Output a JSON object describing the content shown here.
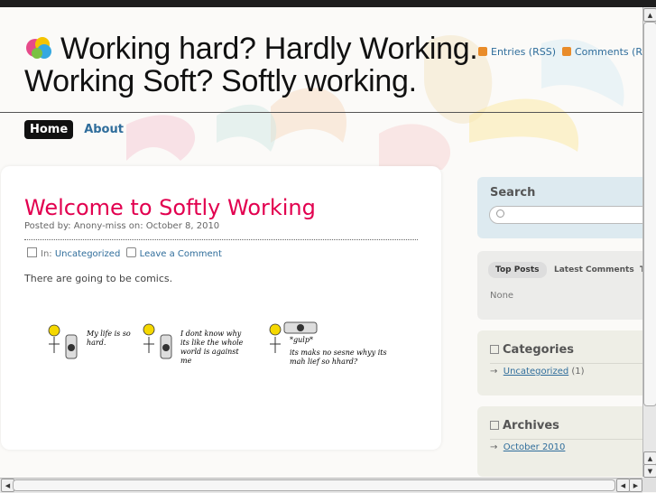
{
  "header": {
    "title_line1": "Working hard? Hardly Working.",
    "title_line2": "Working Soft? Softly working.",
    "rss_entries": "Entries (RSS)",
    "rss_comments": "Comments (RS"
  },
  "nav": {
    "items": [
      {
        "label": "Home"
      },
      {
        "label": "About"
      }
    ]
  },
  "post": {
    "title": "Welcome to Softly Working",
    "meta": "Posted by: Anony-miss on: October 8, 2010",
    "in_label": "In:",
    "category": "Uncategorized",
    "comment_link": "Leave a Comment",
    "body": "There are going to be comics.",
    "comic": {
      "panel1": [
        "My life is so",
        "hard."
      ],
      "panel2": [
        "I dont know why",
        "its like the whole",
        "world is against",
        "me"
      ],
      "panel3": [
        "*gulp*",
        "its maks no sesne whyy its",
        "mah lief so hhard?"
      ]
    }
  },
  "sidebar": {
    "search_label": "Search",
    "tabs": [
      "Top Posts",
      "Latest Comments",
      "T"
    ],
    "tab_empty": "None",
    "categories_title": "Categories",
    "categories": [
      {
        "name": "Uncategorized",
        "count": "(1)"
      }
    ],
    "archives_title": "Archives",
    "archives": [
      {
        "name": "October 2010"
      }
    ]
  },
  "colors": {
    "accent": "#e2004f",
    "link": "#2f6d9b",
    "nav_active_bg": "#111111"
  }
}
